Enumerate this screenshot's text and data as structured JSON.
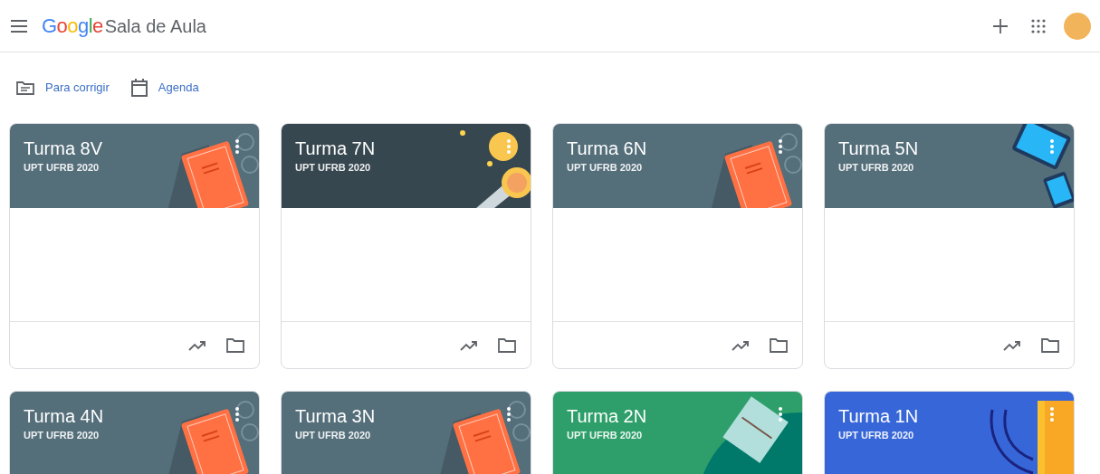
{
  "app_bar": {
    "logo": "Google",
    "product": "Sala de Aula"
  },
  "shortcuts": [
    {
      "kind": "review",
      "label": "Para corrigir"
    },
    {
      "kind": "calendar",
      "label": "Agenda"
    }
  ],
  "classes": [
    {
      "title": "Turma 8V",
      "subtitle": "UPT UFRB 2020",
      "color": "#546e7a",
      "kind": "book"
    },
    {
      "title": "Turma 7N",
      "subtitle": "UPT UFRB 2020",
      "color": "#37474f",
      "kind": "coins"
    },
    {
      "title": "Turma 6N",
      "subtitle": "UPT UFRB 2020",
      "color": "#546e7a",
      "kind": "book"
    },
    {
      "title": "Turma 5N",
      "subtitle": "UPT UFRB 2020",
      "color": "#546e7a",
      "kind": "tablet"
    },
    {
      "title": "Turma 4N",
      "subtitle": "UPT UFRB 2020",
      "color": "#546e7a",
      "kind": "book"
    },
    {
      "title": "Turma 3N",
      "subtitle": "UPT UFRB 2020",
      "color": "#546e7a",
      "kind": "book"
    },
    {
      "title": "Turma 2N",
      "subtitle": "UPT UFRB 2020",
      "color": "#2e9f6a",
      "kind": "notebook"
    },
    {
      "title": "Turma 1N",
      "subtitle": "UPT UFRB 2020",
      "color": "#3766d8",
      "kind": "headphones"
    }
  ]
}
